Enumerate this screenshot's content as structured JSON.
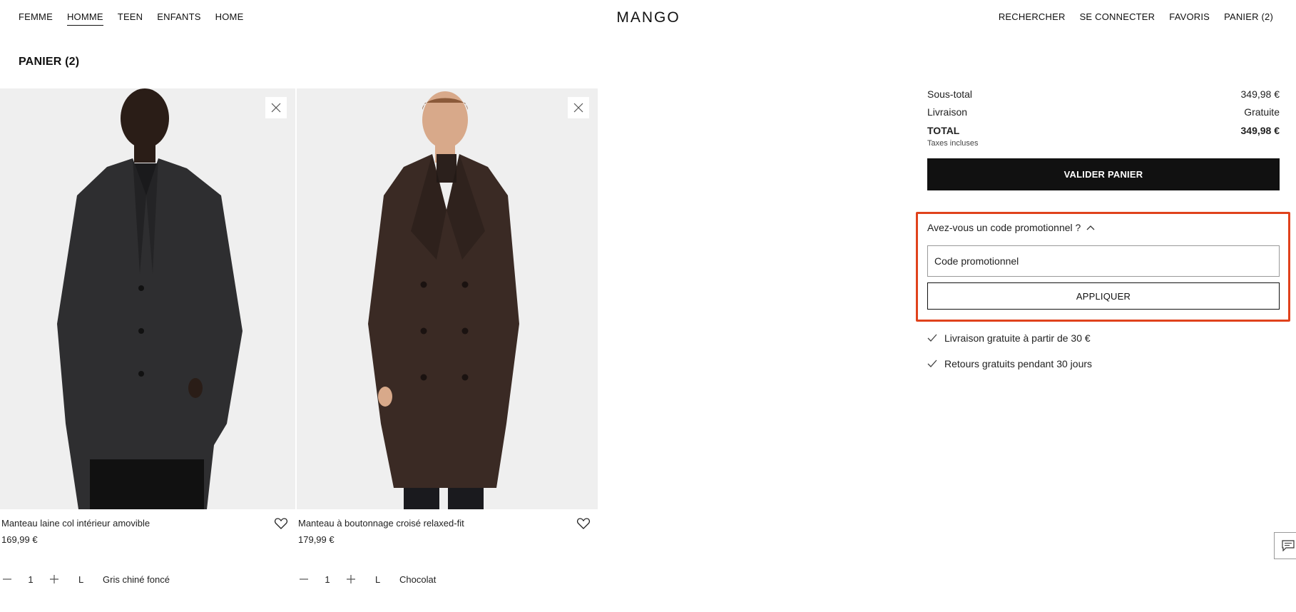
{
  "nav": {
    "left": [
      {
        "label": "FEMME",
        "active": false
      },
      {
        "label": "HOMME",
        "active": true
      },
      {
        "label": "TEEN",
        "active": false
      },
      {
        "label": "ENFANTS",
        "active": false
      },
      {
        "label": "HOME",
        "active": false
      }
    ],
    "logo": "MANGO",
    "right": [
      "RECHERCHER",
      "SE CONNECTER",
      "FAVORIS",
      "PANIER (2)"
    ]
  },
  "page_title": "PANIER (2)",
  "products": [
    {
      "name": "Manteau laine col intérieur amovible",
      "price": "169,99 €",
      "quantity": "1",
      "size": "L",
      "color": "Gris chiné foncé",
      "coat_color": "#2e2e30"
    },
    {
      "name": "Manteau à boutonnage croisé relaxed-fit",
      "price": "179,99 €",
      "quantity": "1",
      "size": "L",
      "color": "Chocolat",
      "coat_color": "#3a2a24"
    }
  ],
  "summary": {
    "subtotal_label": "Sous-total",
    "subtotal_value": "349,98 €",
    "shipping_label": "Livraison",
    "shipping_value": "Gratuite",
    "total_label": "TOTAL",
    "total_value": "349,98 €",
    "tax_note": "Taxes incluses",
    "validate_label": "VALIDER PANIER"
  },
  "promo": {
    "toggle_label": "Avez-vous un code promotionnel ?",
    "placeholder": "Code promotionnel",
    "value": "",
    "apply_label": "APPLIQUER",
    "highlight_color": "#e0421c"
  },
  "perks": [
    "Livraison gratuite à partir de 30 €",
    "Retours gratuits pendant 30 jours"
  ],
  "icons": {
    "remove": "close-icon",
    "favorite": "heart-icon",
    "decrease": "minus-icon",
    "increase": "plus-icon",
    "promo_toggle": "chevron-up-icon",
    "perk": "check-icon",
    "chat": "chat-icon"
  }
}
